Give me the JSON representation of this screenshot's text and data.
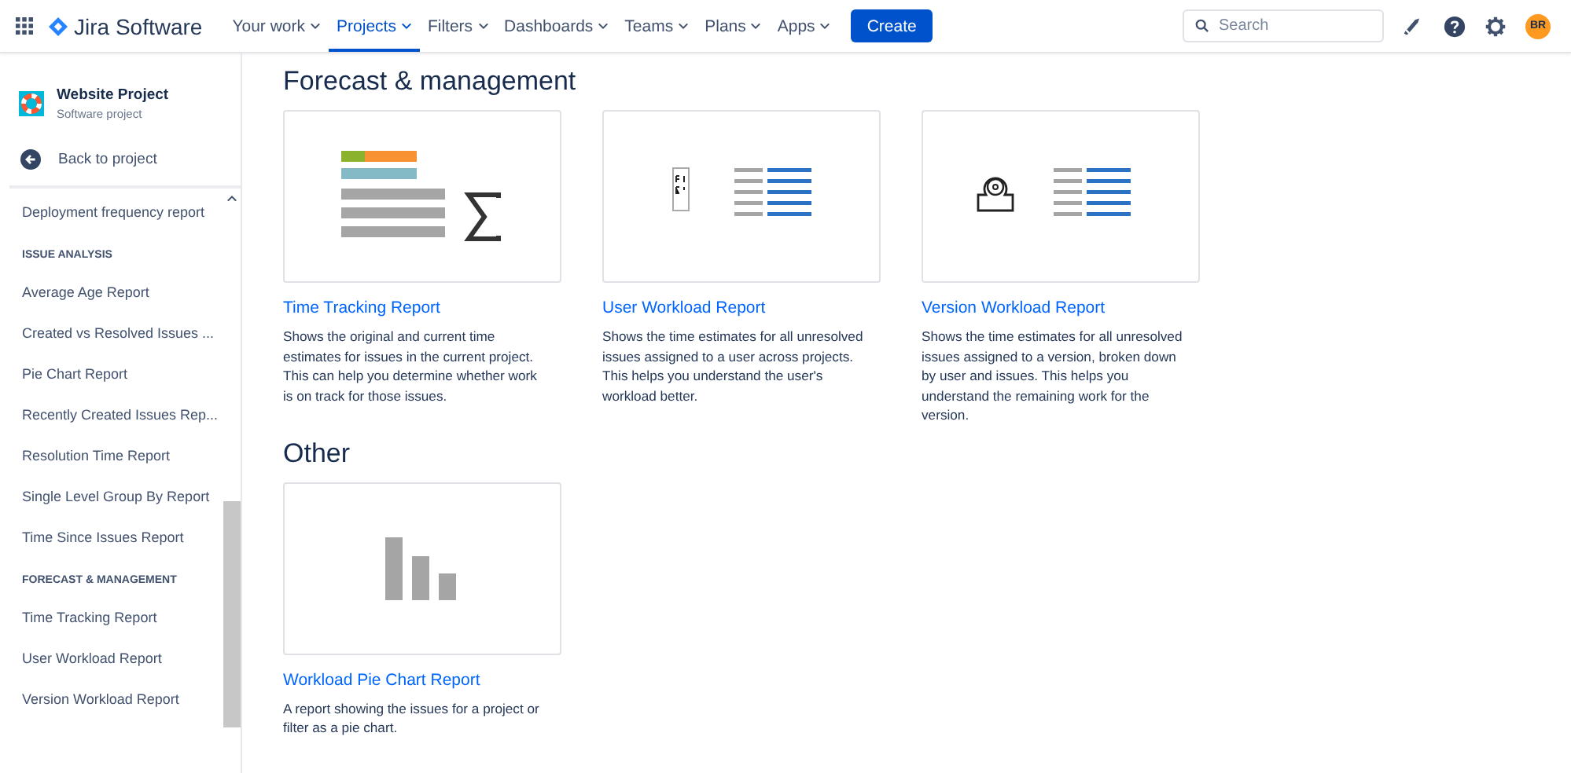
{
  "app": {
    "name": "Jira Software"
  },
  "nav": [
    {
      "label": "Your work",
      "selected": false
    },
    {
      "label": "Projects",
      "selected": true
    },
    {
      "label": "Filters",
      "selected": false
    },
    {
      "label": "Dashboards",
      "selected": false
    },
    {
      "label": "Teams",
      "selected": false
    },
    {
      "label": "Plans",
      "selected": false
    },
    {
      "label": "Apps",
      "selected": false
    }
  ],
  "create_button": "Create",
  "search": {
    "placeholder": "Search"
  },
  "avatar": {
    "initials": "BR"
  },
  "sidebar": {
    "project": {
      "name": "Website Project",
      "type": "Software project"
    },
    "back": "Back to project",
    "items": [
      {
        "kind": "link",
        "label": "Deployment frequency report"
      },
      {
        "kind": "heading",
        "label": "ISSUE ANALYSIS"
      },
      {
        "kind": "link",
        "label": "Average Age Report"
      },
      {
        "kind": "link",
        "label": "Created vs Resolved Issues ..."
      },
      {
        "kind": "link",
        "label": "Pie Chart Report"
      },
      {
        "kind": "link",
        "label": "Recently Created Issues Rep..."
      },
      {
        "kind": "link",
        "label": "Resolution Time Report"
      },
      {
        "kind": "link",
        "label": "Single Level Group By Report"
      },
      {
        "kind": "link",
        "label": "Time Since Issues Report"
      },
      {
        "kind": "heading",
        "label": "FORECAST & MANAGEMENT"
      },
      {
        "kind": "link",
        "label": "Time Tracking Report"
      },
      {
        "kind": "link",
        "label": "User Workload Report"
      },
      {
        "kind": "link",
        "label": "Version Workload Report"
      }
    ]
  },
  "sections": [
    {
      "title": "Forecast & management",
      "reports": [
        {
          "kind": "time-tracking",
          "title": "Time Tracking Report",
          "description": "Shows the original and current time estimates for issues in the current project. This can help you determine whether work is on track for those issues."
        },
        {
          "kind": "user-workload",
          "title": "User Workload Report",
          "description": "Shows the time estimates for all unresolved issues assigned to a user across projects. This helps you understand the user's workload better."
        },
        {
          "kind": "version-workload",
          "title": "Version Workload Report",
          "description": "Shows the time estimates for all unresolved issues assigned to a version, broken down by user and issues. This helps you understand the remaining work for the version."
        }
      ]
    },
    {
      "title": "Other",
      "reports": [
        {
          "kind": "bar-chart",
          "title": "Workload Pie Chart Report",
          "description": "A report showing the issues for a project or filter as a pie chart."
        }
      ]
    }
  ]
}
